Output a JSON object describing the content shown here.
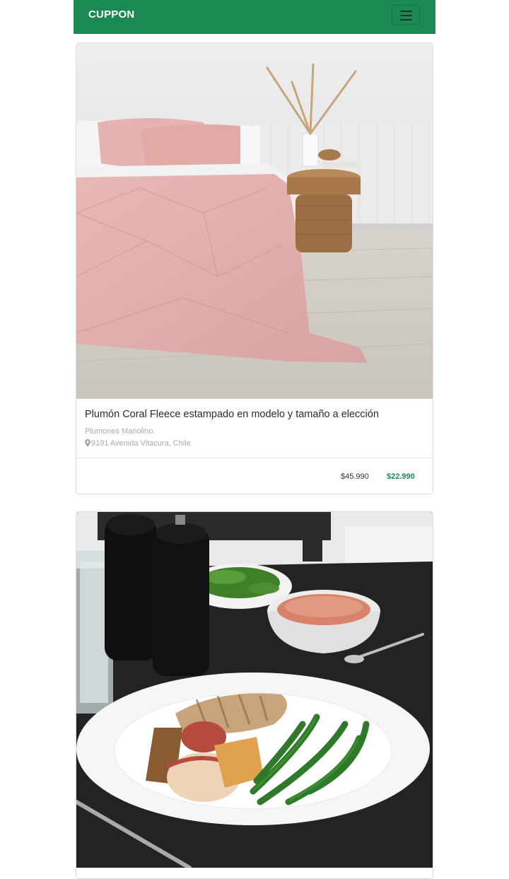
{
  "navbar": {
    "brand": "CUPPON",
    "menu_icon": "hamburger-icon",
    "color": "#1a8a52"
  },
  "deals": [
    {
      "title": "Plumón Coral Fleece estampado en modelo y tamaño a elección",
      "merchant": "Plumones Manolino.",
      "address": "9191 Avenida Vitacura, Chile",
      "old_price": "$45.990",
      "new_price": "$22.990",
      "image": "pink-comforter-bedroom-photo",
      "pin_icon": "map-marker-icon"
    },
    {
      "image": "grilled-chicken-meal-photo"
    }
  ],
  "colors": {
    "accent": "#1a8a52",
    "price_new": "#1a8a52"
  }
}
